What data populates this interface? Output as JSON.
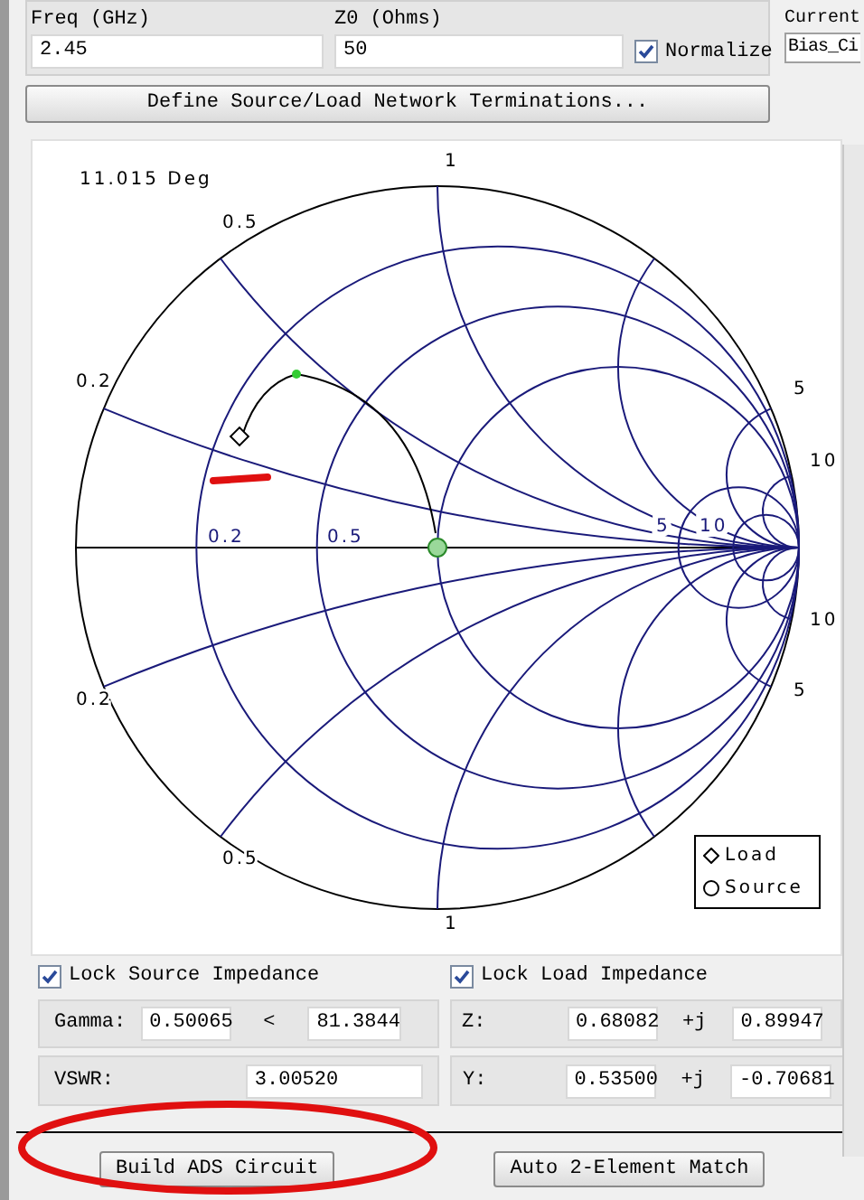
{
  "frequency": {
    "label": "Freq (GHz)",
    "value": "2.45"
  },
  "z0": {
    "label": "Z0 (Ohms)",
    "value": "50"
  },
  "normalize": {
    "label": "Normalize",
    "checked": true
  },
  "current": {
    "label": "Current",
    "value": "Bias_Ci"
  },
  "define_button": "Define Source/Load Network Terminations...",
  "smith_chart": {
    "angle": "11.015 Deg",
    "labels": [
      "1",
      "0.5",
      "0.2",
      "0.2",
      "0.5",
      "5",
      "10",
      "5",
      "10",
      "10",
      "5",
      "0.2",
      "0.5",
      "1"
    ],
    "legend": [
      {
        "kind": "load",
        "label": "Load"
      },
      {
        "kind": "source",
        "label": "Source"
      }
    ]
  },
  "lock_source": {
    "label": "Lock Source Impedance",
    "checked": true
  },
  "lock_load": {
    "label": "Lock Load Impedance",
    "checked": true
  },
  "gamma": {
    "label": "Gamma:",
    "magnitude": "0.50065",
    "separator": "<",
    "angle": "81.3844"
  },
  "z": {
    "label": "Z:",
    "real": "0.68082",
    "j": "+j",
    "imag": "0.89947"
  },
  "vswr": {
    "label": "VSWR:",
    "value": "3.00520"
  },
  "y": {
    "label": "Y:",
    "real": "0.53500",
    "j": "+j",
    "imag": "-0.70681"
  },
  "buttons": [
    "Build ADS Circuit",
    "Auto 2-Element Match"
  ]
}
